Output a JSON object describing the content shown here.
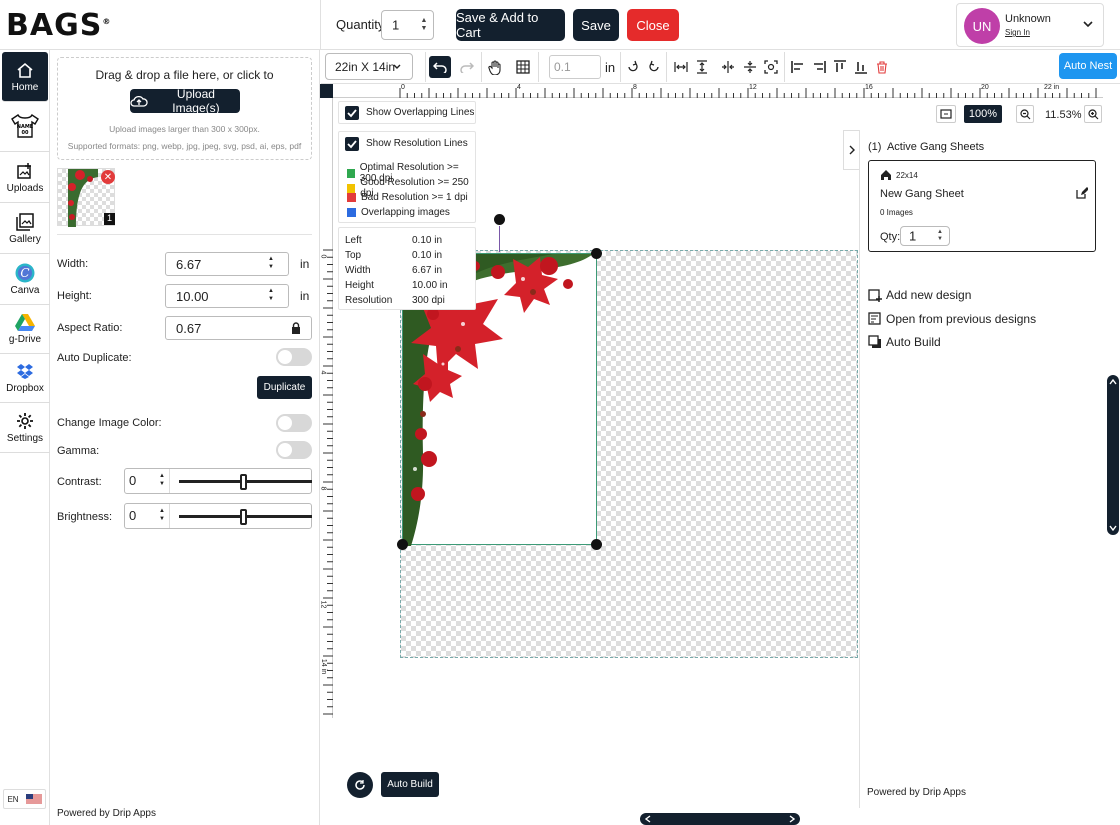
{
  "header": {
    "logo": "BAGS",
    "quantity_label": "Quantity:",
    "quantity_value": "1",
    "save_add_cart": "Save & Add to Cart",
    "save": "Save",
    "close": "Close",
    "user": {
      "initials": "UN",
      "name": "Unknown",
      "sign_in": "Sign In"
    }
  },
  "nav": [
    {
      "label": "Home",
      "icon": "home-icon",
      "active": true
    },
    {
      "label": "",
      "icon": "tshirt-name-icon",
      "active": false
    },
    {
      "label": "Uploads",
      "icon": "upload-icon",
      "active": false
    },
    {
      "label": "Gallery",
      "icon": "gallery-icon",
      "active": false
    },
    {
      "label": "Canva",
      "icon": "canva-icon",
      "active": false
    },
    {
      "label": "g-Drive",
      "icon": "gdrive-icon",
      "active": false
    },
    {
      "label": "Dropbox",
      "icon": "dropbox-icon",
      "active": false
    },
    {
      "label": "Settings",
      "icon": "gear-icon",
      "active": false
    }
  ],
  "lang": "EN",
  "panel": {
    "drop_text": "Drag & drop a file here, or click to",
    "upload_button": "Upload Image(s)",
    "upload_hint": "Upload images larger than 300 x 300px.",
    "formats_hint": "Supported formats: png, webp, jpg, jpeg, svg, psd, ai, eps, pdf",
    "thumb_count": "1",
    "width_label": "Width:",
    "width_value": "6.67",
    "height_label": "Height:",
    "height_value": "10.00",
    "unit": "in",
    "aspect_label": "Aspect Ratio:",
    "aspect_value": "0.67",
    "auto_duplicate_label": "Auto Duplicate:",
    "duplicate_button": "Duplicate",
    "change_color_label": "Change Image Color:",
    "gamma_label": "Gamma:",
    "contrast_label": "Contrast:",
    "contrast_value": "0",
    "brightness_label": "Brightness:",
    "brightness_value": "0",
    "powered_by": "Powered by",
    "powered_brand": "Drip Apps"
  },
  "toolbar": {
    "sheet_size": "22in X 14in",
    "spacing_value": "0.1",
    "spacing_unit": "in",
    "auto_nest": "Auto Nest"
  },
  "ruler": {
    "h_labels": [
      "0",
      "4",
      "8",
      "12",
      "16",
      "20",
      "22 in"
    ],
    "v_labels": [
      "0",
      "4",
      "8",
      "12",
      "14 in"
    ]
  },
  "zoom": {
    "fit": "100%",
    "level": "11.53%"
  },
  "overlay": {
    "show_overlapping": "Show Overlapping Lines",
    "show_resolution": "Show Resolution Lines",
    "legend": [
      {
        "label": "Optimal Resolution >= 300 dpi",
        "color": "#2fa84f"
      },
      {
        "label": "Good Resolution >= 250 dpi",
        "color": "#f2c200"
      },
      {
        "label": "Bad Resolution >= 1 dpi",
        "color": "#e23b3b"
      },
      {
        "label": "Overlapping images",
        "color": "#2c6be0"
      }
    ],
    "info": [
      {
        "k": "Left",
        "v": "0.10 in"
      },
      {
        "k": "Top",
        "v": "0.10 in"
      },
      {
        "k": "Width",
        "v": "6.67 in"
      },
      {
        "k": "Height",
        "v": "10.00 in"
      },
      {
        "k": "Resolution",
        "v": "300 dpi"
      }
    ]
  },
  "right": {
    "title": "(1)  Active Gang Sheets",
    "sheet_size": "22x14",
    "sheet_name": "New Gang Sheet",
    "images": "0 Images",
    "qty_label": "Qty:",
    "qty_value": "1",
    "add_new": "Add new design",
    "open_prev": "Open from previous designs",
    "auto_build": "Auto Build",
    "powered_by": "Powered by",
    "powered_brand": "Drip Apps"
  },
  "canvas": {
    "auto_build": "Auto Build"
  }
}
